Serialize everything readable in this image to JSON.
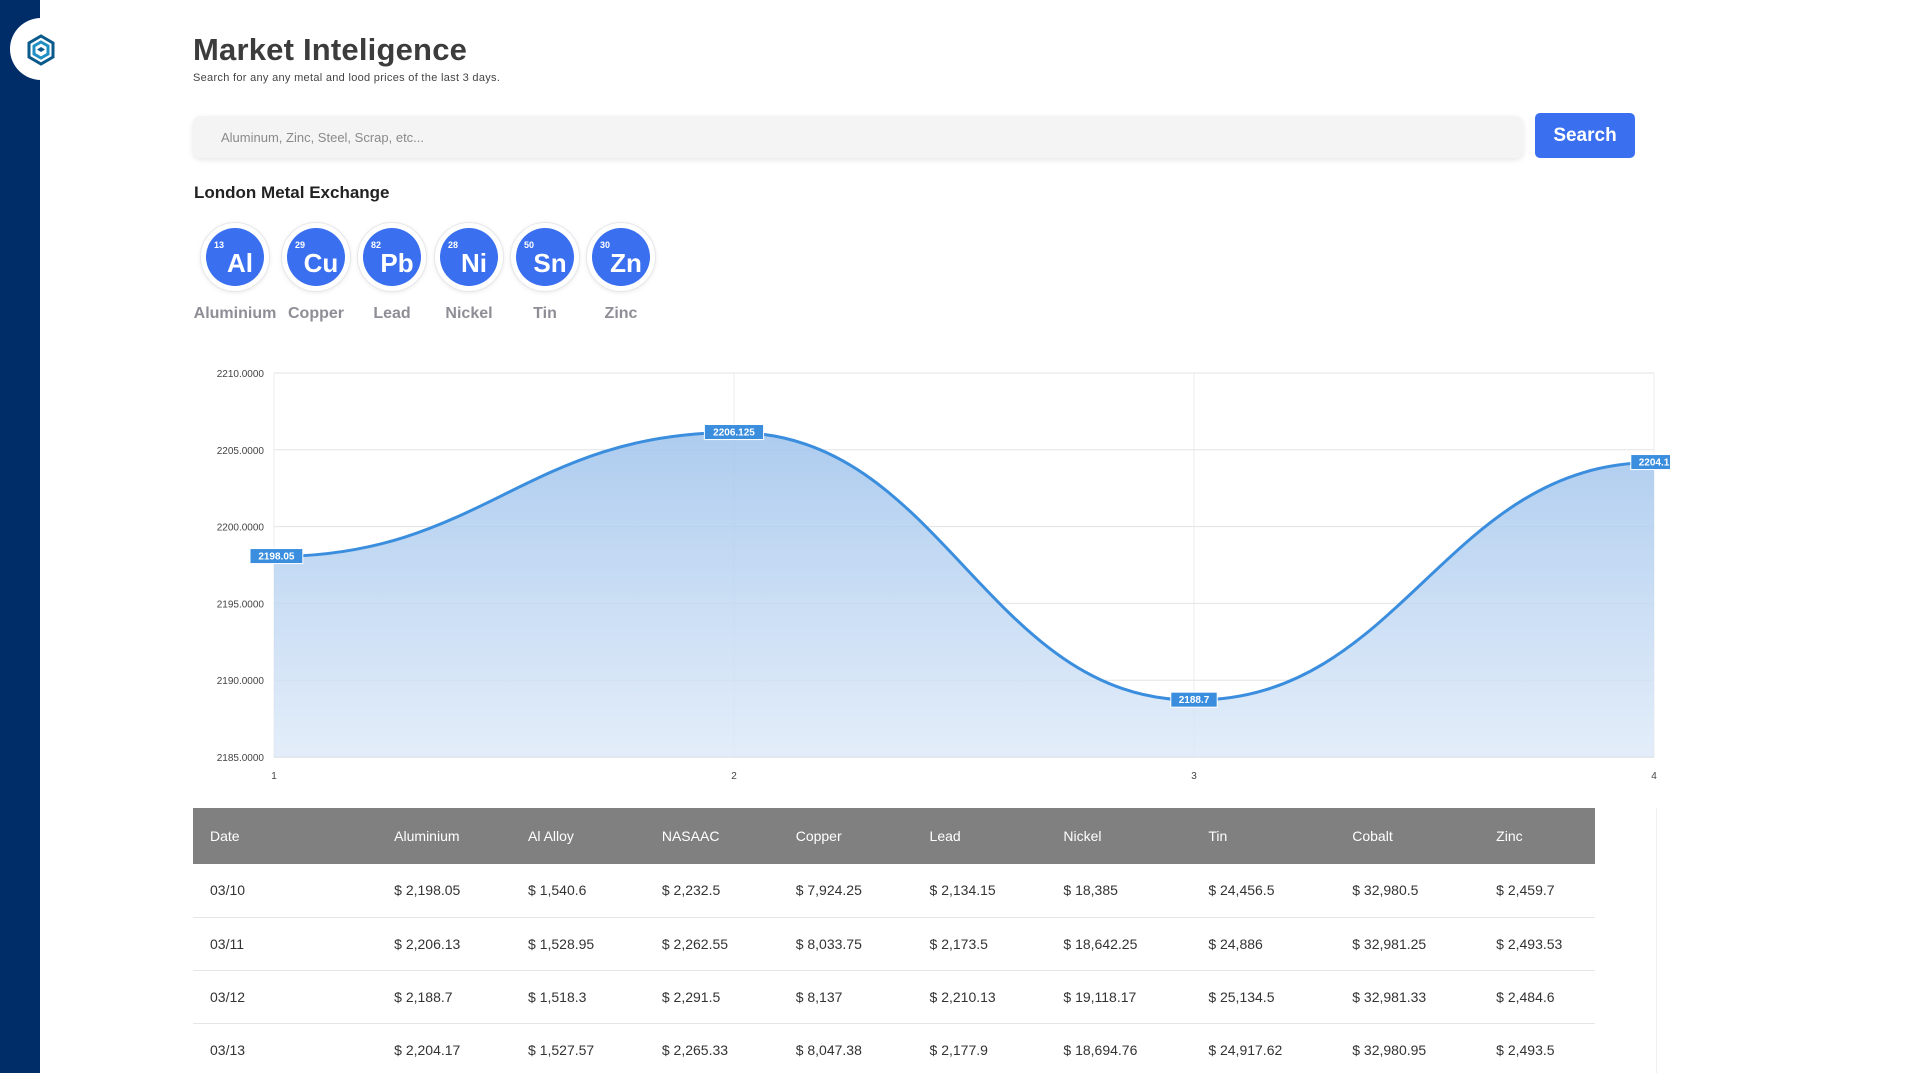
{
  "header": {
    "title": "Market Inteligence",
    "subtitle": "Search for any any metal and lood prices of the last 3 days."
  },
  "search": {
    "placeholder": "Aluminum, Zinc, Steel, Scrap, etc...",
    "button_label": "Search"
  },
  "section_title": "London Metal Exchange",
  "elements": [
    {
      "number": "13",
      "symbol": "Al",
      "name": "Aluminium"
    },
    {
      "number": "29",
      "symbol": "Cu",
      "name": "Copper"
    },
    {
      "number": "82",
      "symbol": "Pb",
      "name": "Lead"
    },
    {
      "number": "28",
      "symbol": "Ni",
      "name": "Nickel"
    },
    {
      "number": "50",
      "symbol": "Sn",
      "name": "Tin"
    },
    {
      "number": "30",
      "symbol": "Zn",
      "name": "Zinc"
    }
  ],
  "colors": {
    "sidebar": "#002c68",
    "accent": "#3a6ff0",
    "line": "#3b8ede",
    "table_header": "#808080"
  },
  "chart_data": {
    "type": "area",
    "x": [
      1,
      2,
      3,
      4
    ],
    "values": [
      2198.05,
      2206.125,
      2188.7,
      2204.17
    ],
    "point_labels": [
      "2198.05",
      "2206.125",
      "2188.7",
      "2204.1"
    ],
    "x_ticks": [
      "1",
      "2",
      "3",
      "4"
    ],
    "y_ticks": [
      "2210.0000",
      "2205.0000",
      "2200.0000",
      "2195.0000",
      "2190.0000",
      "2185.0000"
    ],
    "ylim": [
      2185,
      2210
    ],
    "grid": true,
    "title": "",
    "xlabel": "",
    "ylabel": ""
  },
  "table": {
    "headers": [
      "Date",
      "Aluminium",
      "Al Alloy",
      "NASAAC",
      "Copper",
      "Lead",
      "Nickel",
      "Tin",
      "Cobalt",
      "Zinc"
    ],
    "rows": [
      [
        "03/10",
        "$ 2,198.05",
        "$ 1,540.6",
        "$ 2,232.5",
        "$ 7,924.25",
        "$ 2,134.15",
        "$ 18,385",
        "$ 24,456.5",
        "$ 32,980.5",
        "$ 2,459.7"
      ],
      [
        "03/11",
        "$ 2,206.13",
        "$ 1,528.95",
        "$ 2,262.55",
        "$ 8,033.75",
        "$ 2,173.5",
        "$ 18,642.25",
        "$ 24,886",
        "$ 32,981.25",
        "$ 2,493.53"
      ],
      [
        "03/12",
        "$ 2,188.7",
        "$ 1,518.3",
        "$ 2,291.5",
        "$ 8,137",
        "$ 2,210.13",
        "$ 19,118.17",
        "$ 25,134.5",
        "$ 32,981.33",
        "$ 2,484.6"
      ],
      [
        "03/13",
        "$ 2,204.17",
        "$ 1,527.57",
        "$ 2,265.33",
        "$ 8,047.38",
        "$ 2,177.9",
        "$ 18,694.76",
        "$ 24,917.62",
        "$ 32,980.95",
        "$ 2,493.5"
      ]
    ]
  }
}
